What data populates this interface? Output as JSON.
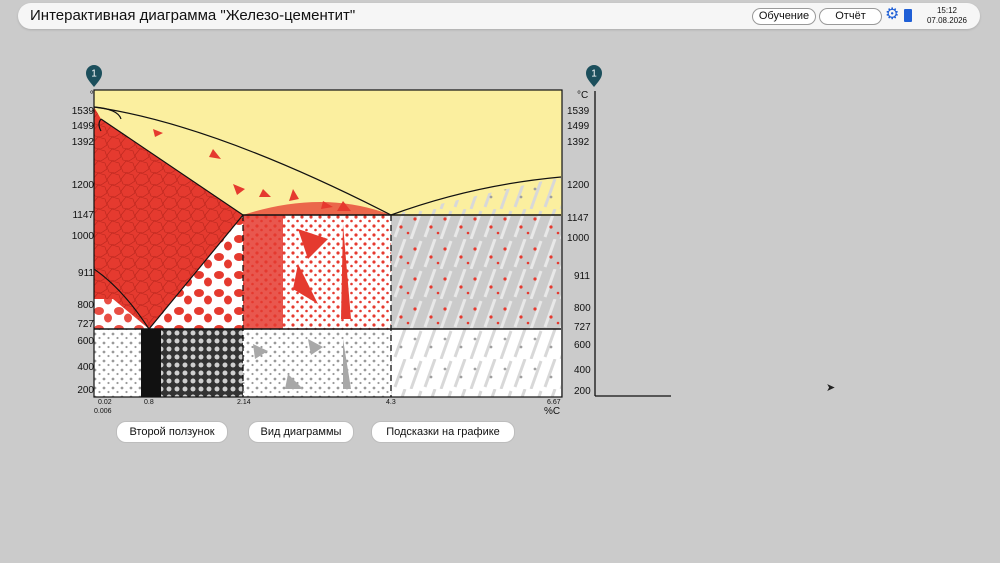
{
  "app": {
    "title": "Интерактивная диаграмма \"Железо-цементит\"",
    "buttons": {
      "learning": "Обучение",
      "report": "Отчёт"
    },
    "icons": {
      "settings": "gear-icon",
      "book": "book-icon"
    },
    "time": "15:12",
    "date": "07.08.2026"
  },
  "diagram": {
    "slider_label": "1",
    "units": {
      "temperature": "°C",
      "carbon": "%C"
    },
    "y_ticks": [
      "1539",
      "1499",
      "1392",
      "1200",
      "1147",
      "1000",
      "911",
      "800",
      "727",
      "600",
      "400",
      "200"
    ],
    "x_ticks": [
      "0.02",
      "0.006",
      "0.8",
      "2.14",
      "4.3",
      "6.67"
    ],
    "colors": {
      "liquid": "#fbef9f",
      "austenite": "#e53a2f",
      "white": "#ffffff"
    }
  },
  "right_panel": {
    "slider_label": "1",
    "unit": "°C",
    "y_ticks": [
      "1539",
      "1499",
      "1392",
      "1200",
      "1147",
      "1000",
      "911",
      "800",
      "727",
      "600",
      "400",
      "200"
    ]
  },
  "controls": {
    "second_slider": "Второй ползунок",
    "diagram_view": "Вид диаграммы",
    "hints": "Подсказки на графике"
  }
}
